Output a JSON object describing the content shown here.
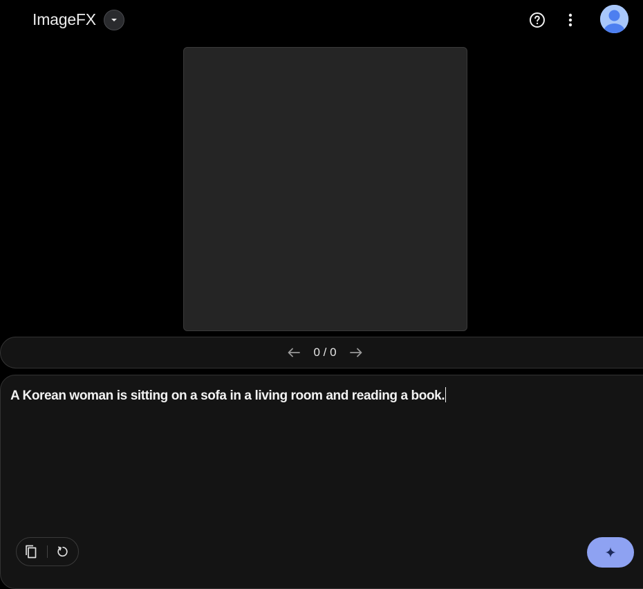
{
  "app": {
    "title": "ImageFX"
  },
  "header": {
    "dropdown_icon": "caret-down-icon",
    "help_icon": "help-circle-icon",
    "more_icon": "more-vert-icon",
    "avatar_icon": "account-avatar-icon"
  },
  "pager": {
    "count": "0 / 0",
    "prev_icon": "arrow-left-icon",
    "next_icon": "arrow-right-icon"
  },
  "prompt": {
    "text": "A Korean woman is sitting on a sofa in a living room and reading a book."
  },
  "tools": {
    "copy_icon": "copy-icon",
    "refresh_icon": "refresh-icon",
    "generate_icon": "sparkle-icon"
  },
  "colors": {
    "background": "#000000",
    "surface": "#141414",
    "image_placeholder": "#252525",
    "accent": "#8ea2f2",
    "avatar": "#a8c7fa"
  }
}
